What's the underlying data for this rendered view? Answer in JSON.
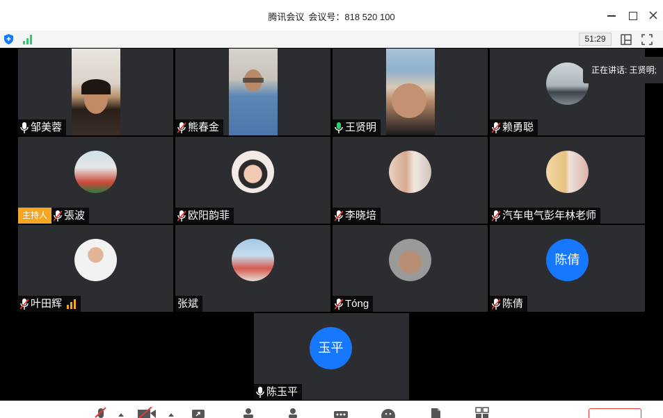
{
  "window": {
    "app_title": "腾讯会议",
    "meeting_id_label": "会议号：",
    "meeting_id": "818 520 100"
  },
  "status": {
    "timer": "51:29"
  },
  "speaking": {
    "label": "正在讲话: 王贤明;"
  },
  "participants": [
    {
      "name": "邹美蓉",
      "mic": "on",
      "media": "video"
    },
    {
      "name": "熊春金",
      "mic": "muted",
      "media": "video"
    },
    {
      "name": "王贤明",
      "mic": "speaking",
      "media": "video"
    },
    {
      "name": "赖勇聪",
      "mic": "muted",
      "media": "avatar"
    },
    {
      "name": "張波",
      "mic": "muted",
      "media": "avatar",
      "host_badge": "主持人"
    },
    {
      "name": "欧阳韵菲",
      "mic": "muted",
      "media": "avatar"
    },
    {
      "name": "李晓培",
      "mic": "muted",
      "media": "avatar"
    },
    {
      "name": "汽车电气彭年林老师",
      "mic": "muted",
      "media": "avatar"
    },
    {
      "name": "叶田辉",
      "mic": "muted",
      "media": "avatar"
    },
    {
      "name": "张斌",
      "mic": "none",
      "media": "avatar"
    },
    {
      "name": "Tóng",
      "mic": "muted",
      "media": "avatar"
    },
    {
      "name": "陈倩",
      "mic": "muted",
      "media": "text-avatar",
      "avatar_text": "陈倩"
    },
    {
      "name": "陈玉平",
      "mic": "on",
      "media": "text-avatar",
      "avatar_text": "玉平"
    }
  ],
  "icons": {
    "status_left": [
      "shield-icon",
      "signal-icon"
    ],
    "status_right": [
      "layout-icon",
      "fullscreen-icon"
    ],
    "toolbar": [
      "mute-mic-icon",
      "stop-video-icon",
      "share-screen-icon",
      "participants-icon",
      "invite-icon",
      "more-icon",
      "emoji-icon",
      "document-icon",
      "apps-icon"
    ]
  },
  "colors": {
    "tile_bg": "#2b2d31",
    "avatar_blue": "#1677ff",
    "host_badge": "#f5a623",
    "speaking_mic": "#2ecc71",
    "muted_mic": "#e53935"
  }
}
